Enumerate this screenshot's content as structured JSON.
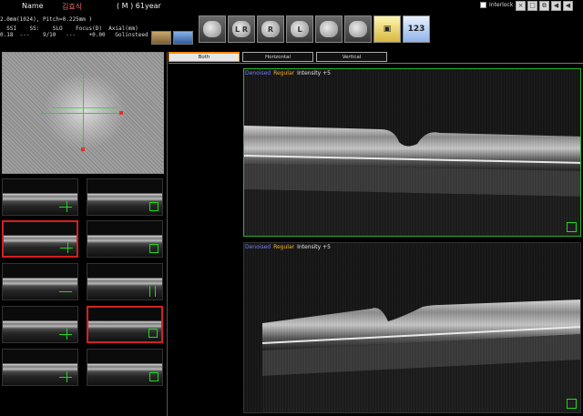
{
  "patient": {
    "name_label": "Name",
    "name_value": "김효식",
    "sex_age": "( M )  61year"
  },
  "scan_info": {
    "line1": "2.0mm(1024), Pitch=0.225mm )",
    "line2_head": "  SSI    SS:    SLO    Focus(D)  Axial(mm)",
    "line2_vals": "0.18  ---    9/10   ---    +0.00   Golinsteed"
  },
  "interlock": {
    "label": "Interlock",
    "checked": false
  },
  "window_controls": [
    "×",
    "□",
    "⧉",
    "◀",
    "◀"
  ],
  "toolbar": [
    {
      "name": "monitor-icon",
      "glyph": ""
    },
    {
      "name": "both-eyes-icon",
      "glyph": "L R"
    },
    {
      "name": "right-eye-icon",
      "glyph": "R"
    },
    {
      "name": "left-eye-icon",
      "glyph": "L"
    },
    {
      "name": "settings-icon",
      "glyph": ""
    },
    {
      "name": "folder-icon",
      "glyph": ""
    },
    {
      "name": "save-icon",
      "glyph": ""
    },
    {
      "name": "report-icon",
      "glyph": "123"
    }
  ],
  "tabs": [
    "Both",
    "Horizontal",
    "Vertical"
  ],
  "active_tab": "Both",
  "bscan_top": {
    "caption_a": "Denoised",
    "caption_b": "Regular",
    "caption_c": "Intensity +5"
  },
  "bscan_bottom": {
    "caption_a": "Denoised",
    "caption_b": "Regular",
    "caption_c": "Intensity +5"
  },
  "thumbnails": [
    {
      "selected": false,
      "marker": "line"
    },
    {
      "selected": false,
      "marker": "box"
    },
    {
      "selected": true,
      "marker": "line"
    },
    {
      "selected": false,
      "marker": "box"
    },
    {
      "selected": false,
      "marker": "line"
    },
    {
      "selected": false,
      "marker": "vline"
    },
    {
      "selected": false,
      "marker": "line"
    },
    {
      "selected": true,
      "marker": "box"
    },
    {
      "selected": false,
      "marker": "line"
    },
    {
      "selected": false,
      "marker": "box"
    }
  ]
}
